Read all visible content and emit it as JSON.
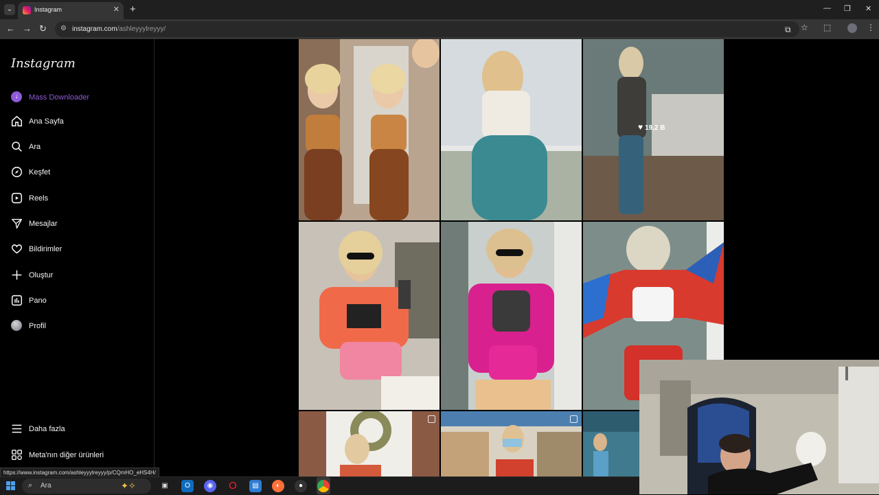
{
  "browser": {
    "tab_title": "Instagram",
    "new_tab_icon": "plus-icon",
    "url_host": "instagram.com",
    "url_path": "/ashleyyylreyyy/",
    "status_url": "https://www.instagram.com/ashleyyylreyyy/p/CQmHO_eHS4H/"
  },
  "instagram": {
    "logo_text": "Instagram",
    "sidebar": {
      "items": [
        {
          "label": "Mass Downloader",
          "icon": "download-circle-icon"
        },
        {
          "label": "Ana Sayfa",
          "icon": "home-icon"
        },
        {
          "label": "Ara",
          "icon": "search-icon"
        },
        {
          "label": "Keşfet",
          "icon": "compass-icon"
        },
        {
          "label": "Reels",
          "icon": "reels-icon"
        },
        {
          "label": "Mesajlar",
          "icon": "send-icon"
        },
        {
          "label": "Bildirimler",
          "icon": "heart-icon"
        },
        {
          "label": "Oluştur",
          "icon": "plus-icon"
        },
        {
          "label": "Pano",
          "icon": "dashboard-icon"
        },
        {
          "label": "Profil",
          "icon": "avatar-icon"
        }
      ],
      "bottom": [
        {
          "label": "Daha fazla",
          "icon": "menu-icon"
        },
        {
          "label": "Meta'nın diğer ürünleri",
          "icon": "meta-products-icon"
        }
      ]
    },
    "hover_likes": "19,2 B"
  },
  "taskbar": {
    "search_placeholder": "Ara",
    "apps": [
      "task-view-icon",
      "outlook-icon",
      "discord-icon",
      "opera-icon",
      "file-explorer-icon",
      "firefox-icon",
      "app-icon",
      "chrome-icon"
    ]
  },
  "colors": {
    "accent_purple": "#8e5ad8",
    "background": "#000000",
    "text": "#f5f5f5"
  }
}
